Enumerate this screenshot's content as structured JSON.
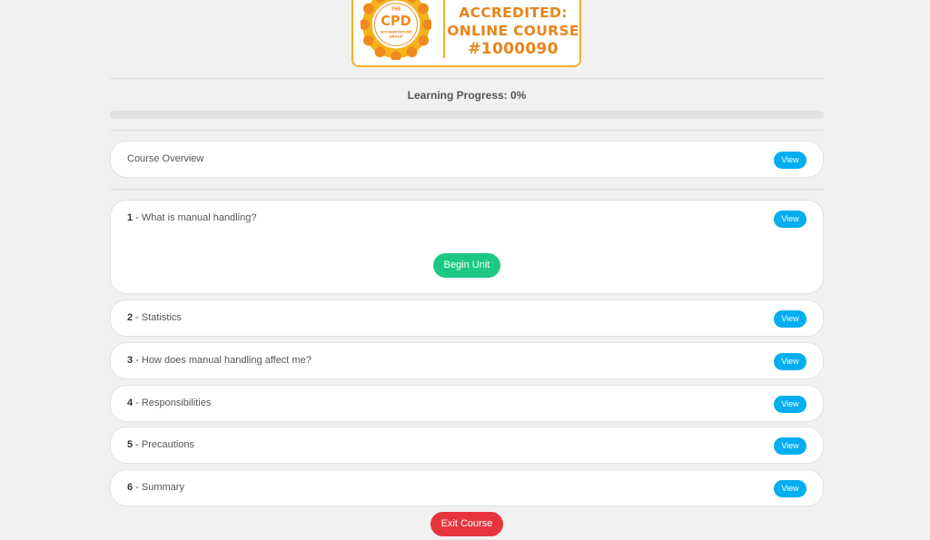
{
  "badge": {
    "seal_top": "THE",
    "seal_main": "CPD",
    "seal_bottom_1": "ACCREDITATION",
    "seal_bottom_2": "GROUP",
    "line1": "ACCREDITED:",
    "line2": "ONLINE COURSE",
    "line3": "#1000090"
  },
  "progress": {
    "label": "Learning Progress: 0%",
    "value": 0
  },
  "overview": {
    "title": "Course Overview",
    "view_label": "View"
  },
  "units": [
    {
      "num": "1",
      "sep": " - ",
      "title": "What is manual handling?",
      "view_label": "View",
      "begin_label": "Begin Unit"
    },
    {
      "num": "2",
      "sep": " - ",
      "title": "Statistics",
      "view_label": "View"
    },
    {
      "num": "3",
      "sep": " - ",
      "title": "How does manual handling affect me?",
      "view_label": "View"
    },
    {
      "num": "4",
      "sep": " - ",
      "title": "Responsibilities",
      "view_label": "View"
    },
    {
      "num": "5",
      "sep": " - ",
      "title": "Precautions",
      "view_label": "View"
    },
    {
      "num": "6",
      "sep": " - ",
      "title": "Summary",
      "view_label": "View"
    }
  ],
  "exit_label": "Exit Course",
  "colors": {
    "accent": "#00aef0",
    "success": "#1dc982",
    "danger": "#e8353d",
    "badge_orange": "#e8841a"
  }
}
